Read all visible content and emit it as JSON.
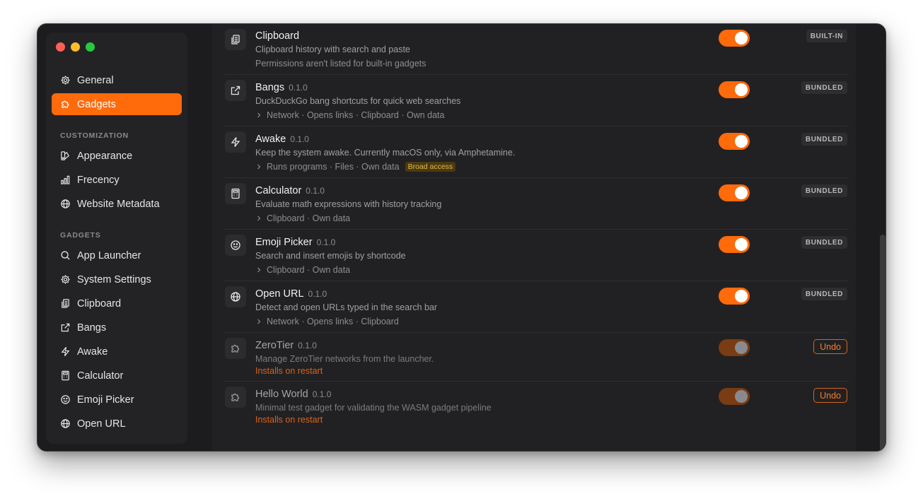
{
  "window": {
    "traffic_lights": [
      "close",
      "minimize",
      "zoom"
    ]
  },
  "sidebar": {
    "top_items": [
      {
        "label": "General",
        "icon": "gear-icon"
      },
      {
        "label": "Gadgets",
        "icon": "puzzle-icon",
        "active": true
      }
    ],
    "customization_label": "CUSTOMIZATION",
    "customization_items": [
      {
        "label": "Appearance",
        "icon": "palette-icon"
      },
      {
        "label": "Frecency",
        "icon": "bar-chart-icon"
      },
      {
        "label": "Website Metadata",
        "icon": "globe-icon"
      }
    ],
    "gadgets_label": "GADGETS",
    "gadget_items": [
      {
        "label": "App Launcher",
        "icon": "search-icon"
      },
      {
        "label": "System Settings",
        "icon": "gear-icon"
      },
      {
        "label": "Clipboard",
        "icon": "clipboard-icon"
      },
      {
        "label": "Bangs",
        "icon": "external-link-icon"
      },
      {
        "label": "Awake",
        "icon": "lightning-icon"
      },
      {
        "label": "Calculator",
        "icon": "calculator-icon"
      },
      {
        "label": "Emoji Picker",
        "icon": "smiley-icon"
      },
      {
        "label": "Open URL",
        "icon": "globe-icon"
      }
    ]
  },
  "gadgets": [
    {
      "name": "Clipboard",
      "version": "",
      "description": "Clipboard history with search and paste",
      "permissions": "Permissions aren't listed for built-in gadgets",
      "badge": "BUILT-IN",
      "enabled": true,
      "icon": "clipboard-icon"
    },
    {
      "name": "Bangs",
      "version": "0.1.0",
      "description": "DuckDuckGo bang shortcuts for quick web searches",
      "permissions": "Network · Opens links · Clipboard · Own data",
      "badge": "BUNDLED",
      "enabled": true,
      "icon": "external-link-icon"
    },
    {
      "name": "Awake",
      "version": "0.1.0",
      "description": "Keep the system awake. Currently macOS only, via Amphetamine.",
      "permissions": "Runs programs · Files · Own data",
      "broad_access": "Broad access",
      "badge": "BUNDLED",
      "enabled": true,
      "icon": "lightning-icon"
    },
    {
      "name": "Calculator",
      "version": "0.1.0",
      "description": "Evaluate math expressions with history tracking",
      "permissions": "Clipboard · Own data",
      "badge": "BUNDLED",
      "enabled": true,
      "icon": "calculator-icon"
    },
    {
      "name": "Emoji Picker",
      "version": "0.1.0",
      "description": "Search and insert emojis by shortcode",
      "permissions": "Clipboard · Own data",
      "badge": "BUNDLED",
      "enabled": true,
      "icon": "smiley-icon"
    },
    {
      "name": "Open URL",
      "version": "0.1.0",
      "description": "Detect and open URLs typed in the search bar",
      "permissions": "Network · Opens links · Clipboard",
      "badge": "BUNDLED",
      "enabled": true,
      "icon": "globe-icon"
    },
    {
      "name": "ZeroTier",
      "version": "0.1.0",
      "description": "Manage ZeroTier networks from the launcher.",
      "restart_note": "Installs on restart",
      "undo_label": "Undo",
      "enabled": false,
      "icon": "puzzle-icon"
    },
    {
      "name": "Hello World",
      "version": "0.1.0",
      "description": "Minimal test gadget for validating the WASM gadget pipeline",
      "restart_note": "Installs on restart",
      "undo_label": "Undo",
      "enabled": false,
      "icon": "puzzle-icon"
    }
  ],
  "colors": {
    "accent": "#ff6a0a",
    "background": "#1c1c1e",
    "warning": "#e8b74a"
  }
}
